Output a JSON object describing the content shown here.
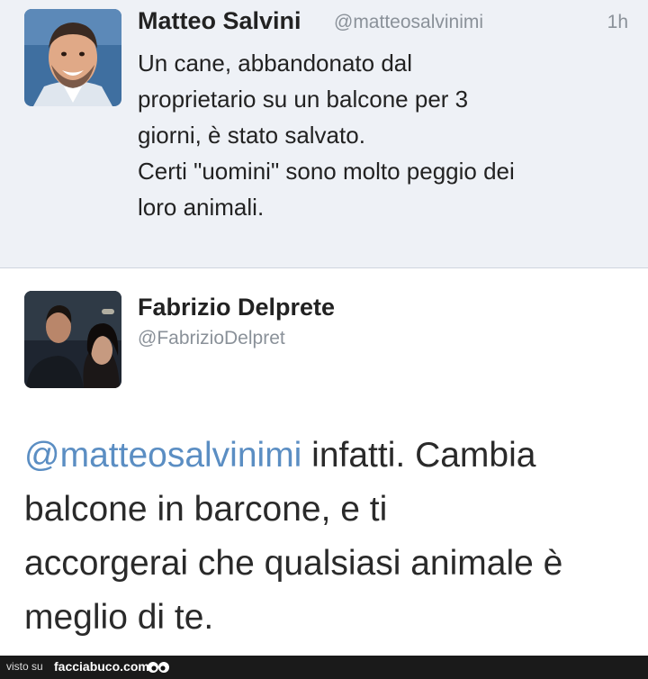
{
  "tweet_1": {
    "name": "Matteo Salvini",
    "handle": "@matteosalvinimi",
    "time": "1h",
    "lines": [
      "Un cane, abbandonato dal",
      "proprietario su un balcone per 3",
      "giorni, è stato salvato.",
      "Certi \"uomini\" sono molto peggio dei",
      "loro animali."
    ]
  },
  "tweet_2": {
    "name": "Fabrizio Delprete",
    "handle": "@FabrizioDelpret",
    "mention": "@matteosalvinimi",
    "line_1_rest": " infatti. Cambia",
    "lines": [
      "balcone in barcone, e ti",
      "accorgerai che qualsiasi animale è",
      "meglio di te."
    ]
  },
  "footer": {
    "label": "visto su",
    "site": "facciabuco.com"
  },
  "colors": {
    "top_bg": "#eef1f6",
    "mention": "#5b8ec3",
    "muted": "#8a9199",
    "footer_bg": "#1a1a1a"
  },
  "icons": {
    "avatar_1": "profile-photo",
    "avatar_2": "profile-photo",
    "footer_logo": "eyes-icon"
  }
}
